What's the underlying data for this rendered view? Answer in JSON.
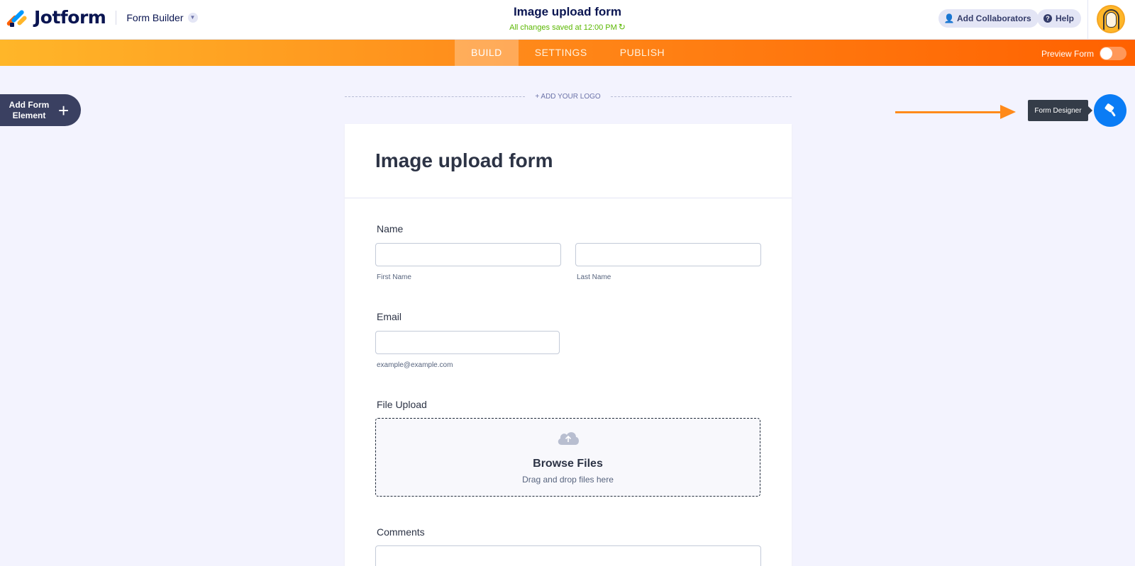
{
  "header": {
    "brand": "Jotform",
    "builder_menu": "Form Builder",
    "form_title": "Image upload form",
    "save_status": "All changes saved at 12:00 PM",
    "collaborators_label": "Add Collaborators",
    "help_label": "Help"
  },
  "nav": {
    "tabs": [
      {
        "label": "BUILD",
        "active": true
      },
      {
        "label": "SETTINGS",
        "active": false
      },
      {
        "label": "PUBLISH",
        "active": false
      }
    ],
    "preview_label": "Preview Form",
    "preview_on": false
  },
  "builder": {
    "add_element_label_line1": "Add Form",
    "add_element_label_line2": "Element",
    "add_logo_label": "+ ADD YOUR LOGO",
    "designer_tooltip": "Form Designer"
  },
  "form": {
    "title": "Image upload form",
    "name_label": "Name",
    "first_name_sublabel": "First Name",
    "last_name_sublabel": "Last Name",
    "email_label": "Email",
    "email_sublabel": "example@example.com",
    "file_upload_label": "File Upload",
    "browse_label": "Browse Files",
    "drag_label": "Drag and drop files here",
    "comments_label": "Comments"
  },
  "colors": {
    "brand_orange": "#ff6100",
    "brand_yellow": "#ffb629",
    "designer_blue": "#0a7cf5",
    "saved_green": "#5ab700",
    "navy": "#0a1551"
  }
}
